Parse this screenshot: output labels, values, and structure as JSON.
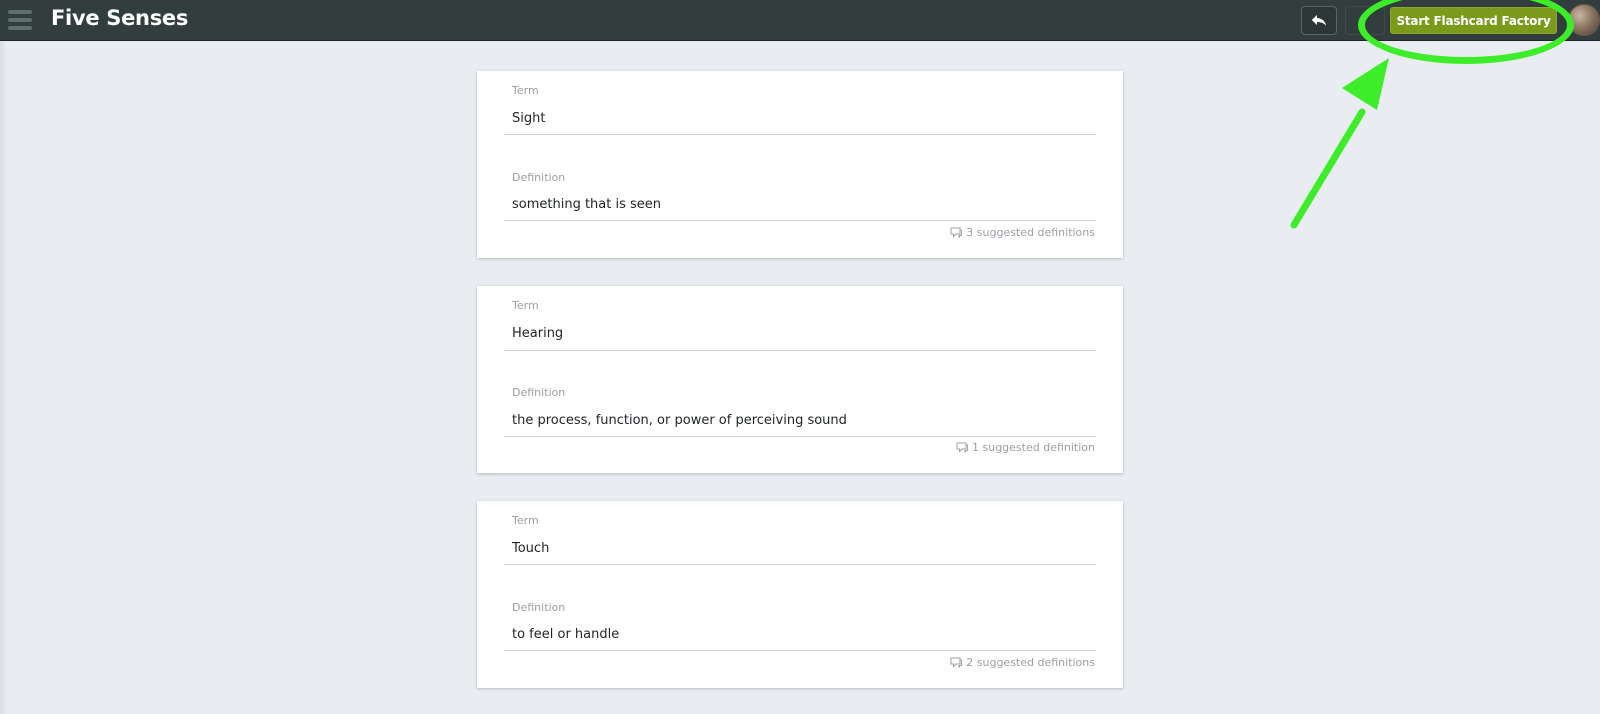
{
  "header": {
    "title": "Five Senses",
    "primary_button": "Start Flashcard Factory"
  },
  "cards": [
    {
      "term_label": "Term",
      "term": "Sight",
      "definition_label": "Definition",
      "definition": "something that is seen",
      "suggestions": "3 suggested definitions"
    },
    {
      "term_label": "Term",
      "term": "Hearing",
      "definition_label": "Definition",
      "definition": "the process, function, or power of perceiving sound",
      "suggestions": "1 suggested definition"
    },
    {
      "term_label": "Term",
      "term": "Touch",
      "definition_label": "Definition",
      "definition": "to feel or handle",
      "suggestions": "2 suggested definitions"
    }
  ],
  "icons": {
    "menu": "hamburger-icon",
    "back": "reply-arrow-icon",
    "suggest": "speech-bubble-icon"
  },
  "colors": {
    "topbar": "#323e3d",
    "primary_button": "#7a9a1c",
    "annotation": "#3ded2a",
    "background": "#e9edf1"
  }
}
